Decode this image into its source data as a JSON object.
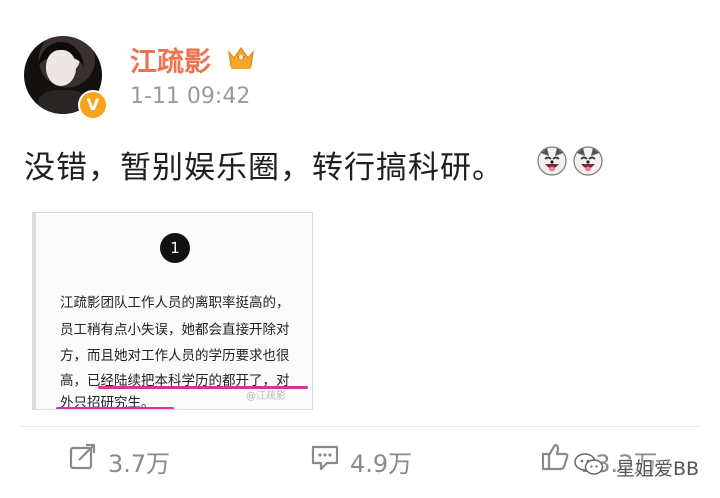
{
  "post": {
    "username": "江疏影",
    "timestamp": "1-11 09:42",
    "verified_mark": "V",
    "text": "没错，暂别娱乐圈，转行搞科研。",
    "emoji_icons": [
      "laughing-dog-emoji",
      "laughing-dog-emoji"
    ]
  },
  "embedded_image": {
    "number": "1",
    "lines": [
      "江疏影团队工作人员的离职率挺高的，",
      "员工稍有点小失误，她都会直接开除对",
      "方，而且她对工作人员的学历要求也很",
      "高，已经陆续把本科学历的都开了，对",
      "外只招研究生。"
    ],
    "watermark": "@江疏影"
  },
  "actions": {
    "repost_count": "3.7万",
    "comment_count": "4.9万",
    "like_count": "13.3万"
  },
  "brand_watermark": "星姐爱BB",
  "colors": {
    "username": "#eb7350",
    "verified_badge": "#f4a51c",
    "highlight_underline": "#d8339a",
    "action_text": "#8a8a8a"
  }
}
